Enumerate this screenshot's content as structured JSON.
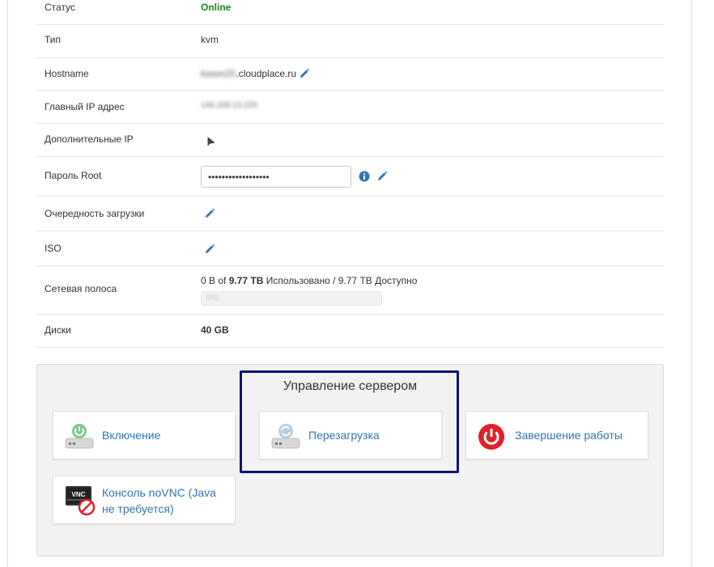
{
  "info": {
    "status_label": "Статус",
    "status_value": "Online",
    "type_label": "Тип",
    "type_value": "kvm",
    "hostname_label": "Hostname",
    "hostname_blur": "kwwe25",
    "hostname_domain": ".cloudplace.ru",
    "main_ip_label": "Главный IP адрес",
    "main_ip_value": "146.158.13.229",
    "extra_ip_label": "Дополнительные IP",
    "root_pwd_label": "Пароль Root",
    "root_pwd_value": "••••••••••••••••••",
    "boot_order_label": "Очередность загрузки",
    "iso_label": "ISO",
    "bandwidth_label": "Сетевая полоса",
    "bandwidth_prefix": "0 B of ",
    "bandwidth_total": "9.77 TB",
    "bandwidth_suffix": " Использовано / 9.77 TB Доступно",
    "bandwidth_used_fraction": 0,
    "bandwidth_bar_text": "0%",
    "disks_label": "Диски",
    "disks_value": "40 GB"
  },
  "control": {
    "title": "Управление сервером",
    "power_on": "Включение",
    "reboot": "Перезагрузка",
    "shutdown": "Завершение работы",
    "console": "Консоль noVNC (Java не требуется)",
    "vnc_text": "VNC"
  },
  "colors": {
    "link": "#3273b3",
    "online": "#1a8a1a",
    "highlight": "#0b1472",
    "shutdown": "#e0202a"
  }
}
